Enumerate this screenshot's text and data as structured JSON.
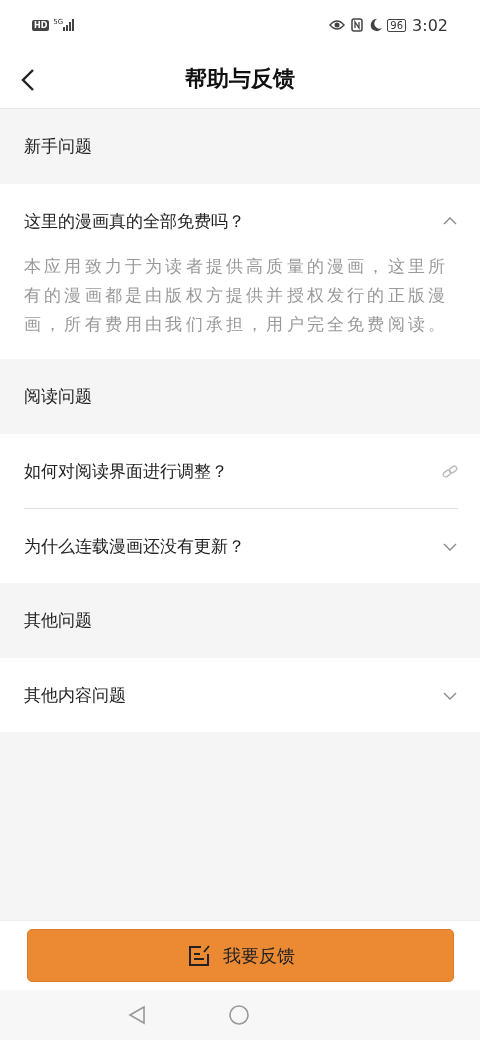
{
  "status_bar": {
    "hd": "HD",
    "network": "5G",
    "battery": "96",
    "time": "3:02"
  },
  "header": {
    "title": "帮助与反馈"
  },
  "sections": [
    {
      "title": "新手问题",
      "items": [
        {
          "kind": "expandable",
          "question": "这里的漫画真的全部免费吗？",
          "expanded": true,
          "answer": "本应用致力于为读者提供高质量的漫画，这里所有的漫画都是由版权方提供并授权发行的正版漫画，所有费用由我们承担，用户完全免费阅读。"
        }
      ]
    },
    {
      "title": "阅读问题",
      "items": [
        {
          "kind": "link",
          "question": "如何对阅读界面进行调整？"
        },
        {
          "kind": "expandable",
          "question": "为什么连载漫画还没有更新？",
          "expanded": false
        }
      ]
    },
    {
      "title": "其他问题",
      "items": [
        {
          "kind": "expandable",
          "question": "其他内容问题",
          "expanded": false
        }
      ]
    }
  ],
  "feedback_button": {
    "label": "我要反馈"
  }
}
